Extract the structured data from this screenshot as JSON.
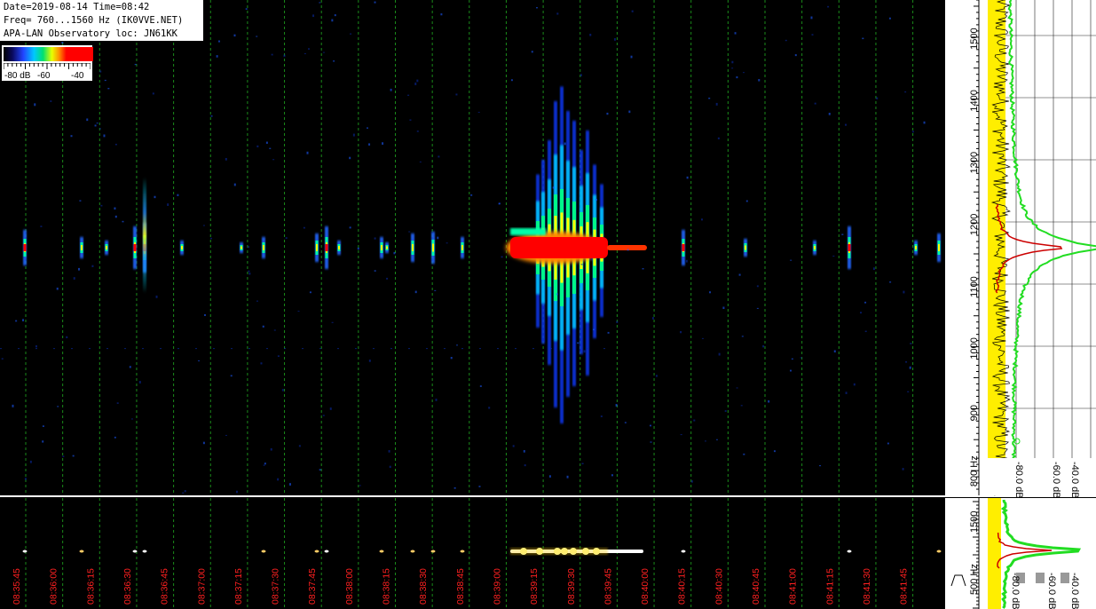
{
  "info": {
    "line1": "Date=2019-08-14 Time=08:42",
    "line2": "Freq= 760...1560 Hz (IK0VVE.NET)",
    "line3": "APA-LAN Observatory loc: JN61KK"
  },
  "color_scale": {
    "labels": [
      "-80 dB",
      "-60",
      "-40"
    ],
    "colors": [
      "#000000",
      "#0a0a60",
      "#2244ff",
      "#00c8ff",
      "#00e070",
      "#e8ff00",
      "#ff9000",
      "#ff0000"
    ]
  },
  "time_axis": {
    "labels": [
      "08:35:45",
      "08:36:00",
      "08:36:15",
      "08:36:30",
      "08:36:45",
      "08:37:00",
      "08:37:15",
      "08:37:30",
      "08:37:45",
      "08:38:00",
      "08:38:15",
      "08:38:30",
      "08:38:45",
      "08:39:00",
      "08:39:15",
      "08:39:30",
      "08:39:45",
      "08:40:00",
      "08:40:15",
      "08:40:30",
      "08:40:45",
      "08:41:00",
      "08:41:15",
      "08:41:30",
      "08:41:45"
    ],
    "color": "#ff2020"
  },
  "freq_axis": {
    "labels": [
      "1500",
      "1400",
      "1300",
      "1200",
      "1100",
      "1000",
      "900",
      "800 Hz"
    ],
    "values": [
      1500,
      1400,
      1300,
      1200,
      1100,
      1000,
      900,
      800
    ],
    "range": [
      760,
      1560
    ]
  },
  "bottom_freq_axis": {
    "labels": [
      "1500",
      "500 Hz"
    ]
  },
  "spectrum_db_labels": [
    "-80.0 dB",
    "-60.0 dB",
    "-40.0 dB"
  ],
  "bottom_db_labels": [
    "-80.0 dB",
    "-60.0 dB",
    "-40.0 dB"
  ],
  "signal_freq_hz": 1160,
  "gridline_color": "#1a8a1a"
}
